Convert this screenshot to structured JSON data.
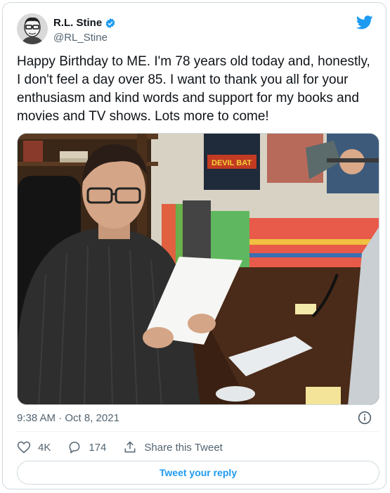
{
  "author": {
    "display_name": "R.L. Stine",
    "handle": "@RL_Stine",
    "verified_icon": "verified-badge-icon"
  },
  "brand": {
    "icon": "twitter-bird-icon",
    "color": "#1d9bf0"
  },
  "tweet": {
    "text": "Happy Birthday to ME. I'm 78 years old today and, honestly, I don't feel a day over 85. I want to thank you all for your enthusiasm and kind words and support for my books and movies and TV shows. Lots more to come!",
    "timestamp": "9:38 AM · Oct 8, 2021"
  },
  "media": {
    "poster_title": "DEVIL BAT"
  },
  "actions": {
    "likes_count": "4K",
    "replies_count": "174",
    "share_label": "Share this Tweet"
  },
  "reply_button_label": "Tweet your reply"
}
